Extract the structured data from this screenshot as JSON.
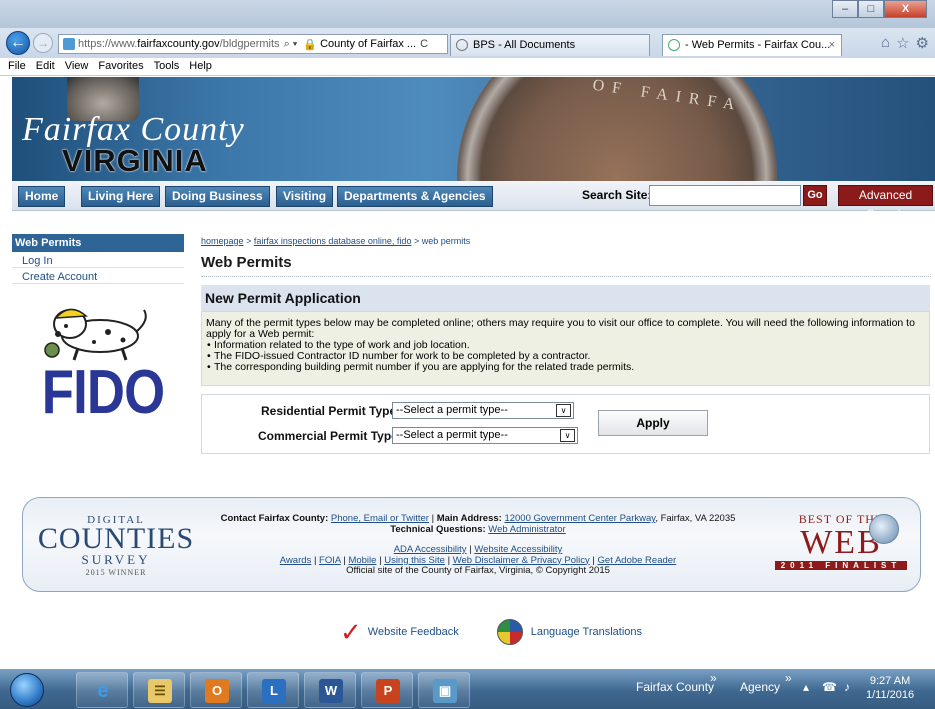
{
  "browser": {
    "url_prefix": "https://www.",
    "url_domain": "fairfaxcounty.gov",
    "url_path": "/bldgpermits",
    "url_controls": "⌕ ▾",
    "site_identity": "County of Fairfax ...",
    "refresh": "C",
    "tabs": [
      {
        "title": "BPS - All Documents"
      },
      {
        "title": "- Web Permits - Fairfax Cou...",
        "close": "×"
      }
    ],
    "toolbar_icons": [
      "home-icon",
      "star-icon",
      "gear-icon"
    ],
    "toolbar_glyphs": {
      "home": "⌂",
      "star": "☆",
      "gear": "⚙"
    },
    "window_buttons": {
      "minimize": "–",
      "maximize": "□",
      "close": "X"
    },
    "menu": [
      "File",
      "Edit",
      "View",
      "Favorites",
      "Tools",
      "Help"
    ]
  },
  "banner": {
    "title_line1": "Fairfax County",
    "title_line2": "VIRGINIA",
    "seal_text": "OF FAIRFA"
  },
  "nav": {
    "items": [
      "Home",
      "Living Here",
      "Doing Business",
      "Visiting",
      "Departments & Agencies"
    ],
    "search_label": "Search Site:",
    "search_value": "",
    "go_label": "Go",
    "advanced_label": "Advanced Search"
  },
  "sidebar": {
    "header": "Web Permits",
    "links": [
      "Log In",
      "Create Account"
    ],
    "logo_text": "FIDO"
  },
  "breadcrumb": {
    "items": [
      "homepage",
      "fairfax inspections database online, fido"
    ],
    "sep": ">",
    "current": "web permits"
  },
  "page": {
    "title": "Web Permits",
    "section_title": "New Permit Application",
    "intro": "Many of the permit types below may be completed online; others may require you to visit our office to complete. You will need the following information to apply for a Web permit:",
    "bullets": [
      "Information related to the type of work and job location.",
      "The FIDO-issued Contractor ID number for work to be completed by a contractor.",
      "The corresponding building permit number if you are applying for the related trade permits."
    ],
    "form": {
      "residential_label": "Residential Permit Type",
      "residential_value": "--Select a permit type--",
      "commercial_label": "Commercial Permit Type",
      "commercial_value": "--Select a permit type--",
      "apply_label": "Apply",
      "dropdown_arrow": "∨"
    }
  },
  "footer": {
    "dcs": {
      "l1": "DIGITAL",
      "l2": "COUNTIES",
      "l3": "SURVEY",
      "l4": "2015 WINNER"
    },
    "contact_label": "Contact Fairfax County:",
    "contact_link": "Phone, Email or Twitter",
    "main_address_label": "Main Address:",
    "main_address_link": "12000 Government Center Parkway",
    "main_address_rest": ", Fairfax, VA 22035",
    "tech_label": "Technical Questions:",
    "tech_link": "Web Administrator",
    "access_links": [
      "ADA Accessibility",
      "Website Accessibility"
    ],
    "links": [
      "Awards",
      "FOIA",
      "Mobile",
      "Using this Site",
      "Web Disclaimer & Privacy Policy",
      "Get Adobe Reader"
    ],
    "link_sep": "|",
    "copyright": "Official site of the County of Fairfax, Virginia, © Copyright 2015",
    "bow": {
      "b1": "BEST OF THE",
      "b2": "WEB",
      "b3": "2011 FINALIST"
    },
    "feedback_glyph": "✓",
    "feedback": "Website Feedback",
    "translations": "Language Translations"
  },
  "taskbar": {
    "apps": [
      "internet-explorer",
      "file-explorer",
      "outlook",
      "lync",
      "word",
      "powerpoint",
      "photo-viewer"
    ],
    "app_glyphs": [
      "e",
      "☰",
      "O",
      "L",
      "W",
      "P",
      "▣"
    ],
    "toolbar1": "Fairfax County",
    "toolbar2": "Agency",
    "chevron": "»",
    "tray_up": "▴",
    "tray_net": "☎",
    "tray_vol": "♪",
    "time": "9:27 AM",
    "date": "1/11/2016"
  }
}
